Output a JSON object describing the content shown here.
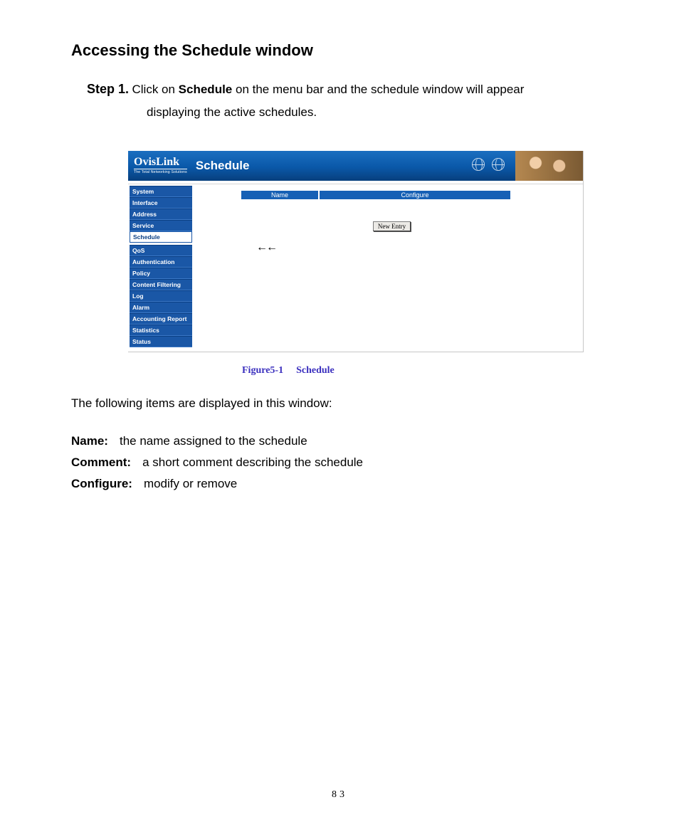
{
  "page": {
    "title": "Accessing the Schedule window",
    "step_label": "Step 1.",
    "step_text_1_prefix": " Click on ",
    "step_text_1_bold": "Schedule",
    "step_text_1_suffix": " on the menu bar and the schedule window will appear",
    "step_text_2": "displaying the active schedules.",
    "desc_intro": "The following items are displayed in this window:",
    "fields": [
      {
        "key": "Name:",
        "value": "the name assigned to the schedule"
      },
      {
        "key": "Comment:",
        "value": "a short comment describing the schedule"
      },
      {
        "key": "Configure:",
        "value": "modify or remove"
      }
    ],
    "page_number": "83"
  },
  "figure": {
    "caption_a": "Figure5-1",
    "caption_b": "Schedule",
    "logo_main": "OvisLink",
    "logo_sub": "The Total Networking Solutions",
    "header_title": "Schedule",
    "sidebar": [
      "System",
      "Interface",
      "Address",
      "Service",
      "Schedule",
      "QoS",
      "Authentication",
      "Policy",
      "Content Filtering",
      "Log",
      "Alarm",
      "Accounting Report",
      "Statistics",
      "Status"
    ],
    "selected_index": 4,
    "table_headers": {
      "name": "Name",
      "configure": "Configure"
    },
    "button_label": "New Entry",
    "pointer": "←←"
  }
}
